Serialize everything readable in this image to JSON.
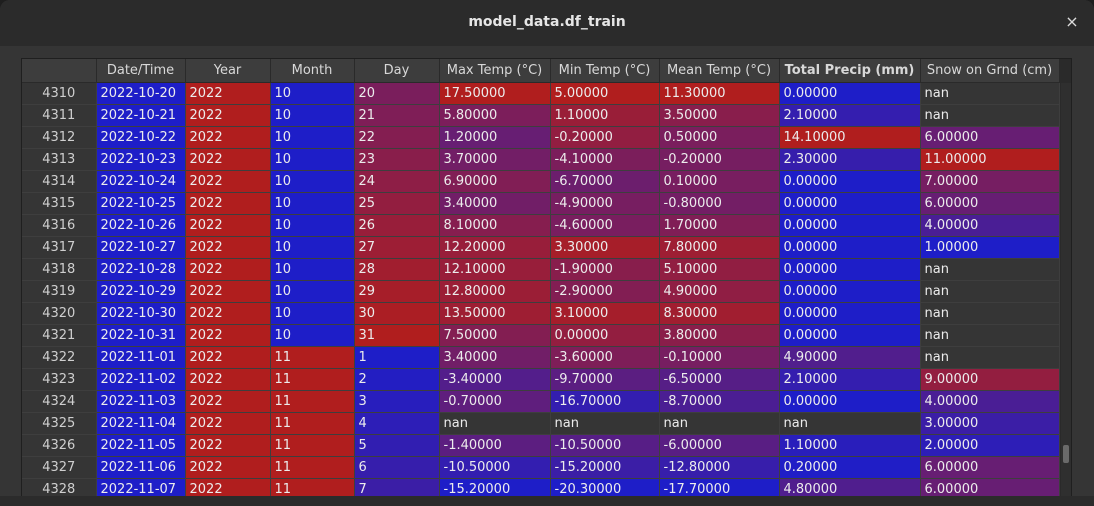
{
  "window": {
    "title": "model_data.df_train",
    "close_icon": "×"
  },
  "table": {
    "columns": [
      "",
      "Date/Time",
      "Year",
      "Month",
      "Day",
      "Max Temp (°C)",
      "Min Temp (°C)",
      "Mean Temp (°C)",
      "Total Precip (mm)",
      "Snow on Grnd (cm)"
    ],
    "rows": [
      [
        "4310",
        "2022-10-20",
        "2022",
        "10",
        "20",
        "17.50000",
        "5.00000",
        "11.30000",
        "0.00000",
        "nan"
      ],
      [
        "4311",
        "2022-10-21",
        "2022",
        "10",
        "21",
        "5.80000",
        "1.10000",
        "3.50000",
        "2.10000",
        "nan"
      ],
      [
        "4312",
        "2022-10-22",
        "2022",
        "10",
        "22",
        "1.20000",
        "-0.20000",
        "0.50000",
        "14.10000",
        "6.00000"
      ],
      [
        "4313",
        "2022-10-23",
        "2022",
        "10",
        "23",
        "3.70000",
        "-4.10000",
        "-0.20000",
        "2.30000",
        "11.00000"
      ],
      [
        "4314",
        "2022-10-24",
        "2022",
        "10",
        "24",
        "6.90000",
        "-6.70000",
        "0.10000",
        "0.00000",
        "7.00000"
      ],
      [
        "4315",
        "2022-10-25",
        "2022",
        "10",
        "25",
        "3.40000",
        "-4.90000",
        "-0.80000",
        "0.00000",
        "6.00000"
      ],
      [
        "4316",
        "2022-10-26",
        "2022",
        "10",
        "26",
        "8.10000",
        "-4.60000",
        "1.70000",
        "0.00000",
        "4.00000"
      ],
      [
        "4317",
        "2022-10-27",
        "2022",
        "10",
        "27",
        "12.20000",
        "3.30000",
        "7.80000",
        "0.00000",
        "1.00000"
      ],
      [
        "4318",
        "2022-10-28",
        "2022",
        "10",
        "28",
        "12.10000",
        "-1.90000",
        "5.10000",
        "0.00000",
        "nan"
      ],
      [
        "4319",
        "2022-10-29",
        "2022",
        "10",
        "29",
        "12.80000",
        "-2.90000",
        "4.90000",
        "0.00000",
        "nan"
      ],
      [
        "4320",
        "2022-10-30",
        "2022",
        "10",
        "30",
        "13.50000",
        "3.10000",
        "8.30000",
        "0.00000",
        "nan"
      ],
      [
        "4321",
        "2022-10-31",
        "2022",
        "10",
        "31",
        "7.50000",
        "0.00000",
        "3.80000",
        "0.00000",
        "nan"
      ],
      [
        "4322",
        "2022-11-01",
        "2022",
        "11",
        "1",
        "3.40000",
        "-3.60000",
        "-0.10000",
        "4.90000",
        "nan"
      ],
      [
        "4323",
        "2022-11-02",
        "2022",
        "11",
        "2",
        "-3.40000",
        "-9.70000",
        "-6.50000",
        "2.10000",
        "9.00000"
      ],
      [
        "4324",
        "2022-11-03",
        "2022",
        "11",
        "3",
        "-0.70000",
        "-16.70000",
        "-8.70000",
        "0.00000",
        "4.00000"
      ],
      [
        "4325",
        "2022-11-04",
        "2022",
        "11",
        "4",
        "nan",
        "nan",
        "nan",
        "nan",
        "3.00000"
      ],
      [
        "4326",
        "2022-11-05",
        "2022",
        "11",
        "5",
        "-1.40000",
        "-10.50000",
        "-6.00000",
        "1.10000",
        "2.00000"
      ],
      [
        "4327",
        "2022-11-06",
        "2022",
        "11",
        "6",
        "-10.50000",
        "-15.20000",
        "-12.80000",
        "0.20000",
        "6.00000"
      ],
      [
        "4328",
        "2022-11-07",
        "2022",
        "11",
        "7",
        "-15.20000",
        "-20.30000",
        "-17.70000",
        "4.80000",
        "6.00000"
      ]
    ]
  },
  "colors": {
    "low": "#1e1ec8",
    "high": "#b01e1e",
    "nan": "#353535"
  }
}
